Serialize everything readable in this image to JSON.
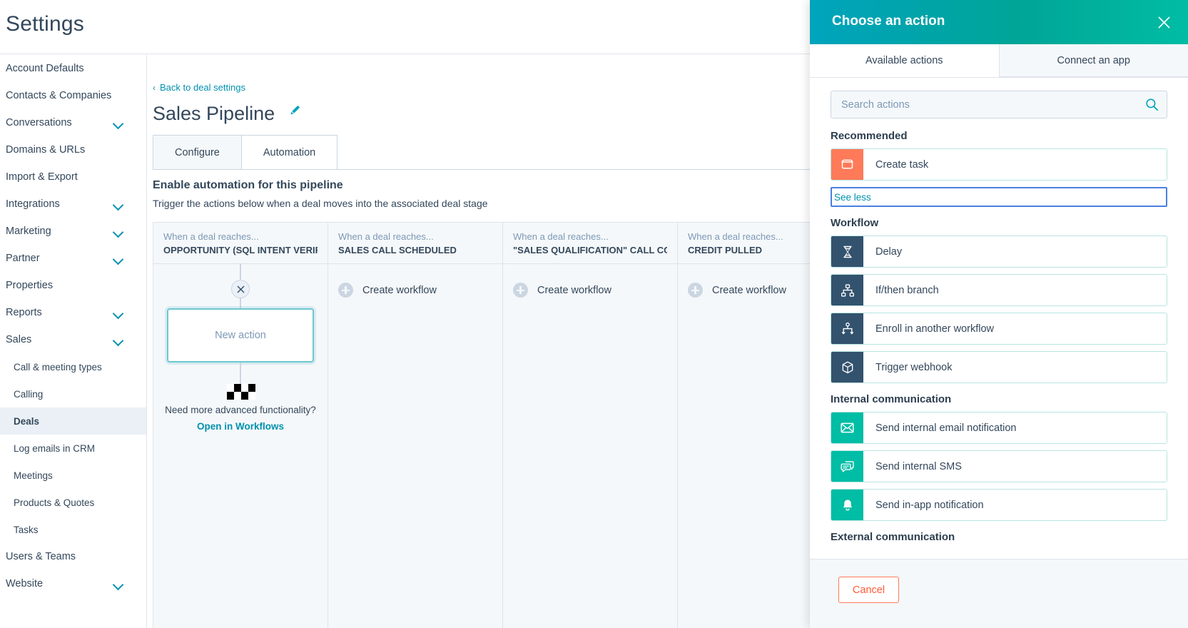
{
  "topbar": {
    "title": "Settings"
  },
  "sidebar": {
    "items": [
      {
        "label": "Account Defaults",
        "chevron": false,
        "child": false,
        "active": false
      },
      {
        "label": "Contacts & Companies",
        "chevron": false,
        "child": false,
        "active": false
      },
      {
        "label": "Conversations",
        "chevron": true,
        "child": false,
        "active": false
      },
      {
        "label": "Domains & URLs",
        "chevron": false,
        "child": false,
        "active": false
      },
      {
        "label": "Import & Export",
        "chevron": false,
        "child": false,
        "active": false
      },
      {
        "label": "Integrations",
        "chevron": true,
        "child": false,
        "active": false
      },
      {
        "label": "Marketing",
        "chevron": true,
        "child": false,
        "active": false
      },
      {
        "label": "Partner",
        "chevron": true,
        "child": false,
        "active": false
      },
      {
        "label": "Properties",
        "chevron": false,
        "child": false,
        "active": false
      },
      {
        "label": "Reports",
        "chevron": true,
        "child": false,
        "active": false
      },
      {
        "label": "Sales",
        "chevron": true,
        "child": false,
        "active": false
      },
      {
        "label": "Call & meeting types",
        "chevron": false,
        "child": true,
        "active": false
      },
      {
        "label": "Calling",
        "chevron": false,
        "child": true,
        "active": false
      },
      {
        "label": "Deals",
        "chevron": false,
        "child": true,
        "active": true
      },
      {
        "label": "Log emails in CRM",
        "chevron": false,
        "child": true,
        "active": false
      },
      {
        "label": "Meetings",
        "chevron": false,
        "child": true,
        "active": false
      },
      {
        "label": "Products & Quotes",
        "chevron": false,
        "child": true,
        "active": false
      },
      {
        "label": "Tasks",
        "chevron": false,
        "child": true,
        "active": false
      },
      {
        "label": "Users & Teams",
        "chevron": false,
        "child": false,
        "active": false
      },
      {
        "label": "Website",
        "chevron": true,
        "child": false,
        "active": false
      }
    ]
  },
  "main": {
    "back_link": "Back to deal settings",
    "back_caret": "‹",
    "page_title": "Sales Pipeline",
    "tabs": [
      {
        "label": "Configure",
        "active": false
      },
      {
        "label": "Automation",
        "active": true
      }
    ],
    "section_heading": "Enable automation for this pipeline",
    "section_sub": "Trigger the actions below when a deal moves into the associated deal stage",
    "stage_when_label": "When a deal reaches...",
    "stages": [
      {
        "name": "OPPORTUNITY (SQL INTENT VERIFIED)",
        "has_flow": true
      },
      {
        "name": "SALES CALL SCHEDULED",
        "has_flow": false
      },
      {
        "name": "\"SALES QUALIFICATION\" CALL COMP…",
        "has_flow": false
      },
      {
        "name": "CREDIT PULLED",
        "has_flow": false
      }
    ],
    "create_workflow_label": "Create workflow",
    "new_action_label": "New action",
    "need_more_text": "Need more advanced functionality?",
    "open_in_workflows": "Open in Workflows"
  },
  "panel": {
    "title": "Choose an action",
    "tabs": [
      {
        "label": "Available actions",
        "active": true
      },
      {
        "label": "Connect an app",
        "active": false
      }
    ],
    "search_placeholder": "Search actions",
    "search_value": "",
    "see_less_label": "See less",
    "groups": [
      {
        "heading": "Recommended",
        "items": [
          {
            "label": "Create task",
            "icon": "task-icon",
            "color": "orange"
          }
        ]
      },
      {
        "heading": "Workflow",
        "items": [
          {
            "label": "Delay",
            "icon": "hourglass-icon",
            "color": "navy"
          },
          {
            "label": "If/then branch",
            "icon": "branch-icon",
            "color": "navy"
          },
          {
            "label": "Enroll in another workflow",
            "icon": "enroll-icon",
            "color": "navy"
          },
          {
            "label": "Trigger webhook",
            "icon": "cube-icon",
            "color": "navy"
          }
        ]
      },
      {
        "heading": "Internal communication",
        "items": [
          {
            "label": "Send internal email notification",
            "icon": "envelope-icon",
            "color": "green"
          },
          {
            "label": "Send internal SMS",
            "icon": "chat-icon",
            "color": "green"
          },
          {
            "label": "Send in-app notification",
            "icon": "bell-icon",
            "color": "green"
          }
        ]
      },
      {
        "heading": "External communication",
        "items": []
      }
    ],
    "cancel_label": "Cancel"
  },
  "colors": {
    "brand_orange": "#ff7a59",
    "teal": "#00bda5",
    "cyan": "#00a4bd",
    "navy": "#33526e",
    "link": "#0091ae",
    "text": "#33475b"
  }
}
